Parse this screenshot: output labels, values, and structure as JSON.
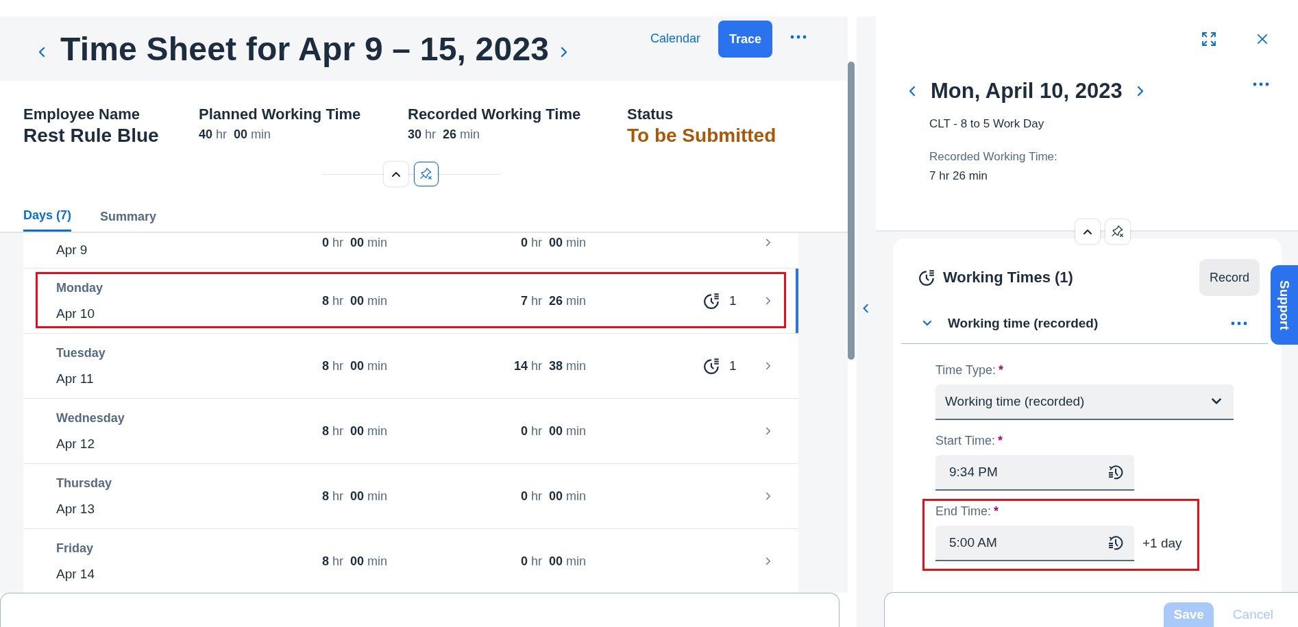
{
  "header": {
    "title": "Time Sheet for Apr 9 – 15, 2023",
    "actions": [
      {
        "label": "Calendar",
        "kind": "link"
      },
      {
        "label": "Trace",
        "kind": "primary"
      }
    ]
  },
  "summary": [
    {
      "label": "Employee Name",
      "kind": "text",
      "value": "Rest Rule Blue"
    },
    {
      "label": "Planned Working Time",
      "kind": "duration",
      "value": "**40** hr  **00** min"
    },
    {
      "label": "Recorded Working Time",
      "kind": "duration",
      "value": "**30** hr  **26** min"
    },
    {
      "label": "Status",
      "kind": "status",
      "value": "To be Submitted"
    }
  ],
  "tabs": [
    {
      "label": "Days (7)",
      "selected": true
    },
    {
      "label": "Summary",
      "selected": false
    }
  ],
  "days": [
    {
      "date": "Apr 9",
      "planned": "**0** hr  **00** min",
      "recorded": "**0** hr  **00** min",
      "selected": false,
      "highlighted": false
    },
    {
      "weekday": "Monday",
      "date": "Apr 10",
      "planned": "**8** hr  **00** min",
      "recorded": "**7** hr  **26** min",
      "entries": "1",
      "selected": true,
      "highlighted": true
    },
    {
      "weekday": "Tuesday",
      "date": "Apr 11",
      "planned": "**8** hr  **00** min",
      "recorded": "**14** hr  **38** min",
      "entries": "1",
      "selected": false,
      "highlighted": false
    },
    {
      "weekday": "Wednesday",
      "date": "Apr 12",
      "planned": "**8** hr  **00** min",
      "recorded": "**0** hr  **00** min",
      "selected": false,
      "highlighted": false
    },
    {
      "weekday": "Thursday",
      "date": "Apr 13",
      "planned": "**8** hr  **00** min",
      "recorded": "**0** hr  **00** min",
      "selected": false,
      "highlighted": false
    },
    {
      "weekday": "Friday",
      "date": "Apr 14",
      "planned": "**8** hr  **00** min",
      "recorded": "**0** hr  **00** min",
      "selected": false,
      "highlighted": false
    }
  ],
  "detail": {
    "title": "Mon, April 10, 2023",
    "schedule": "CLT - 8 to 5 Work Day",
    "recorded_label": "Recorded Working Time:",
    "recorded_value": "7 hr 26 min"
  },
  "section": {
    "title": "Working Times (1)",
    "button": "Record",
    "entry": {
      "title": "Working time (recorded)",
      "expanded": true
    },
    "fields": [
      {
        "kind": "select",
        "label": "Time Type:",
        "required_mark": "*",
        "value": "Working time (recorded)",
        "highlighted": false
      },
      {
        "kind": "time",
        "label": "Start Time:",
        "required_mark": "*",
        "value": "9:34 PM",
        "highlighted": false
      },
      {
        "kind": "time",
        "label": "End Time:",
        "required_mark": "*",
        "value": "5:00 AM",
        "note": "+1 day",
        "highlighted": true
      }
    ]
  },
  "footer": {
    "buttons": [
      {
        "label": "Save",
        "kind": "primary",
        "disabled": true
      },
      {
        "label": "Cancel",
        "kind": "secondary",
        "disabled": true
      }
    ]
  },
  "support_tab": {
    "label": "Support"
  }
}
